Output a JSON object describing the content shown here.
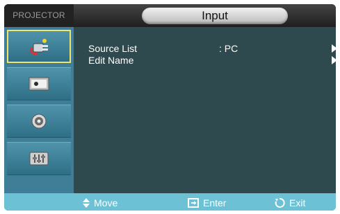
{
  "header": {
    "brand": "PROJECTOR",
    "title": "Input"
  },
  "sidebar": {
    "items": [
      {
        "name": "sidebar-item-input",
        "icon": "plug-icon",
        "active": true
      },
      {
        "name": "sidebar-item-picture",
        "icon": "picture-icon",
        "active": false
      },
      {
        "name": "sidebar-item-setup",
        "icon": "gear-icon",
        "active": false
      },
      {
        "name": "sidebar-item-option",
        "icon": "equalizer-icon",
        "active": false
      }
    ]
  },
  "menu": {
    "items": [
      {
        "label": "Source List",
        "value": ": PC"
      },
      {
        "label": "Edit Name",
        "value": ""
      }
    ]
  },
  "footer": {
    "move_label": "Move",
    "enter_label": "Enter",
    "exit_label": "Exit"
  },
  "colors": {
    "background": "#2f4a4f",
    "sidebar": "#3f7e96",
    "footer": "#6cc2d4",
    "highlight": "#f3e46a"
  }
}
